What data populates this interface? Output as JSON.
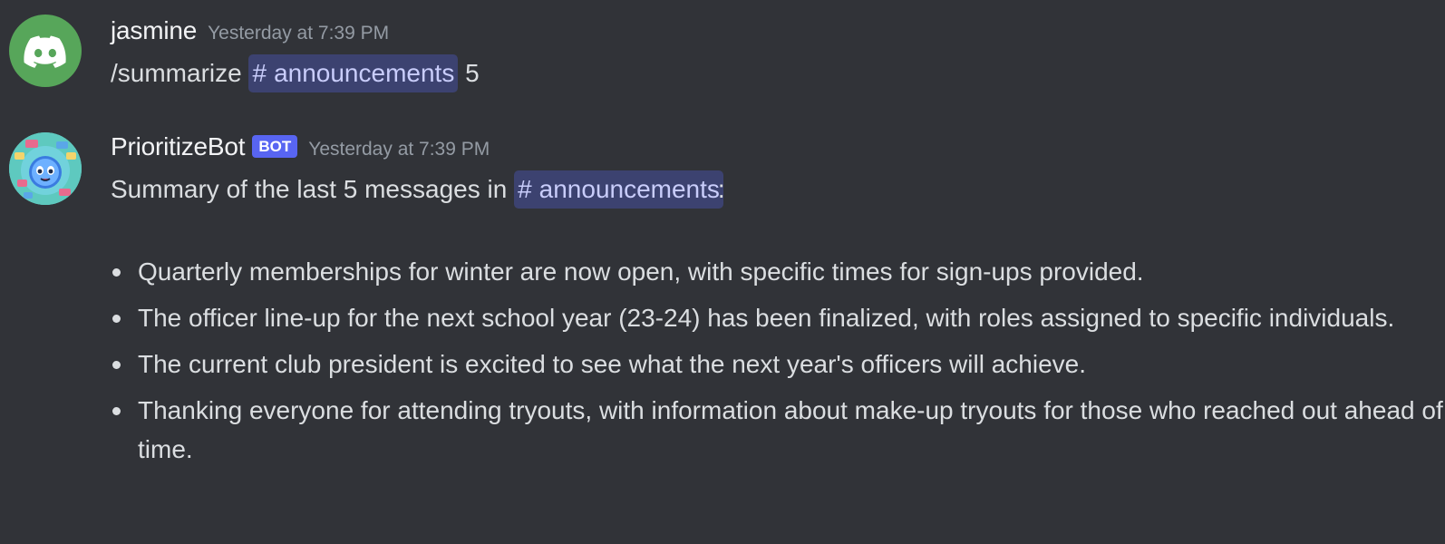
{
  "messages": [
    {
      "author": "jasmine",
      "timestamp": "Yesterday at 7:39 PM",
      "avatar_icon": "discord-logo-icon",
      "avatar_color": "#57a65a",
      "content": {
        "command": "/summarize",
        "channel_mention": "announcements",
        "argument": "5"
      }
    },
    {
      "author": "PrioritizeBot",
      "bot_tag": "BOT",
      "timestamp": "Yesterday at 7:39 PM",
      "avatar_icon": "bot-blob-icon",
      "avatar_color": "#5ec9bf",
      "content": {
        "intro_prefix": "Summary of the last 5 messages in",
        "channel_mention": "announcements",
        "intro_suffix": ":",
        "summary_items": [
          "Quarterly memberships for winter are now open, with specific times for sign-ups provided.",
          "The officer line-up for the next school year (23-24) has been finalized, with roles assigned to specific individuals.",
          "The current club president is excited to see what the next year's officers will achieve.",
          "Thanking everyone for attending tryouts, with information about make-up tryouts for those who reached out ahead of time."
        ]
      }
    }
  ],
  "colors": {
    "background": "#313338",
    "mention_bg": "#3c4270",
    "mention_text": "#c9cdfb",
    "bot_tag_bg": "#5865f2",
    "timestamp": "#949ba4"
  }
}
